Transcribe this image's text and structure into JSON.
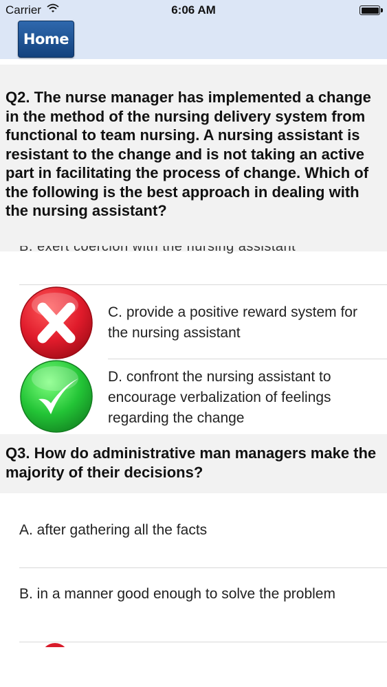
{
  "status_bar": {
    "carrier": "Carrier",
    "time": "6:06 AM",
    "wifi_icon": "wifi-icon",
    "battery_icon": "battery-icon"
  },
  "nav": {
    "home_label": "Home"
  },
  "q2": {
    "question": "Q2. The nurse manager has implemented a change in the method of the nursing delivery system from functional to team nursing. A nursing assistant is resistant to the change and is not taking an active part in facilitating the process of change. Which of the following is the best approach in dealing with the nursing assistant?",
    "option_b_cut": "B. exert coercion with the nursing assistant",
    "options": [
      {
        "label": "C. provide a positive reward system for the nursing assistant",
        "result_icon": "wrong-answer-icon",
        "color": "#e02232"
      },
      {
        "label": "D. confront the nursing assistant to encourage verbalization of feelings regarding the change",
        "result_icon": "correct-answer-icon",
        "color": "#2bc43a"
      }
    ]
  },
  "q3": {
    "question": "Q3. How do administrative man managers make the majority of their decisions?",
    "options": [
      {
        "label": "A. after gathering all the facts"
      },
      {
        "label": "B. in a manner good enough to solve the problem"
      }
    ]
  }
}
